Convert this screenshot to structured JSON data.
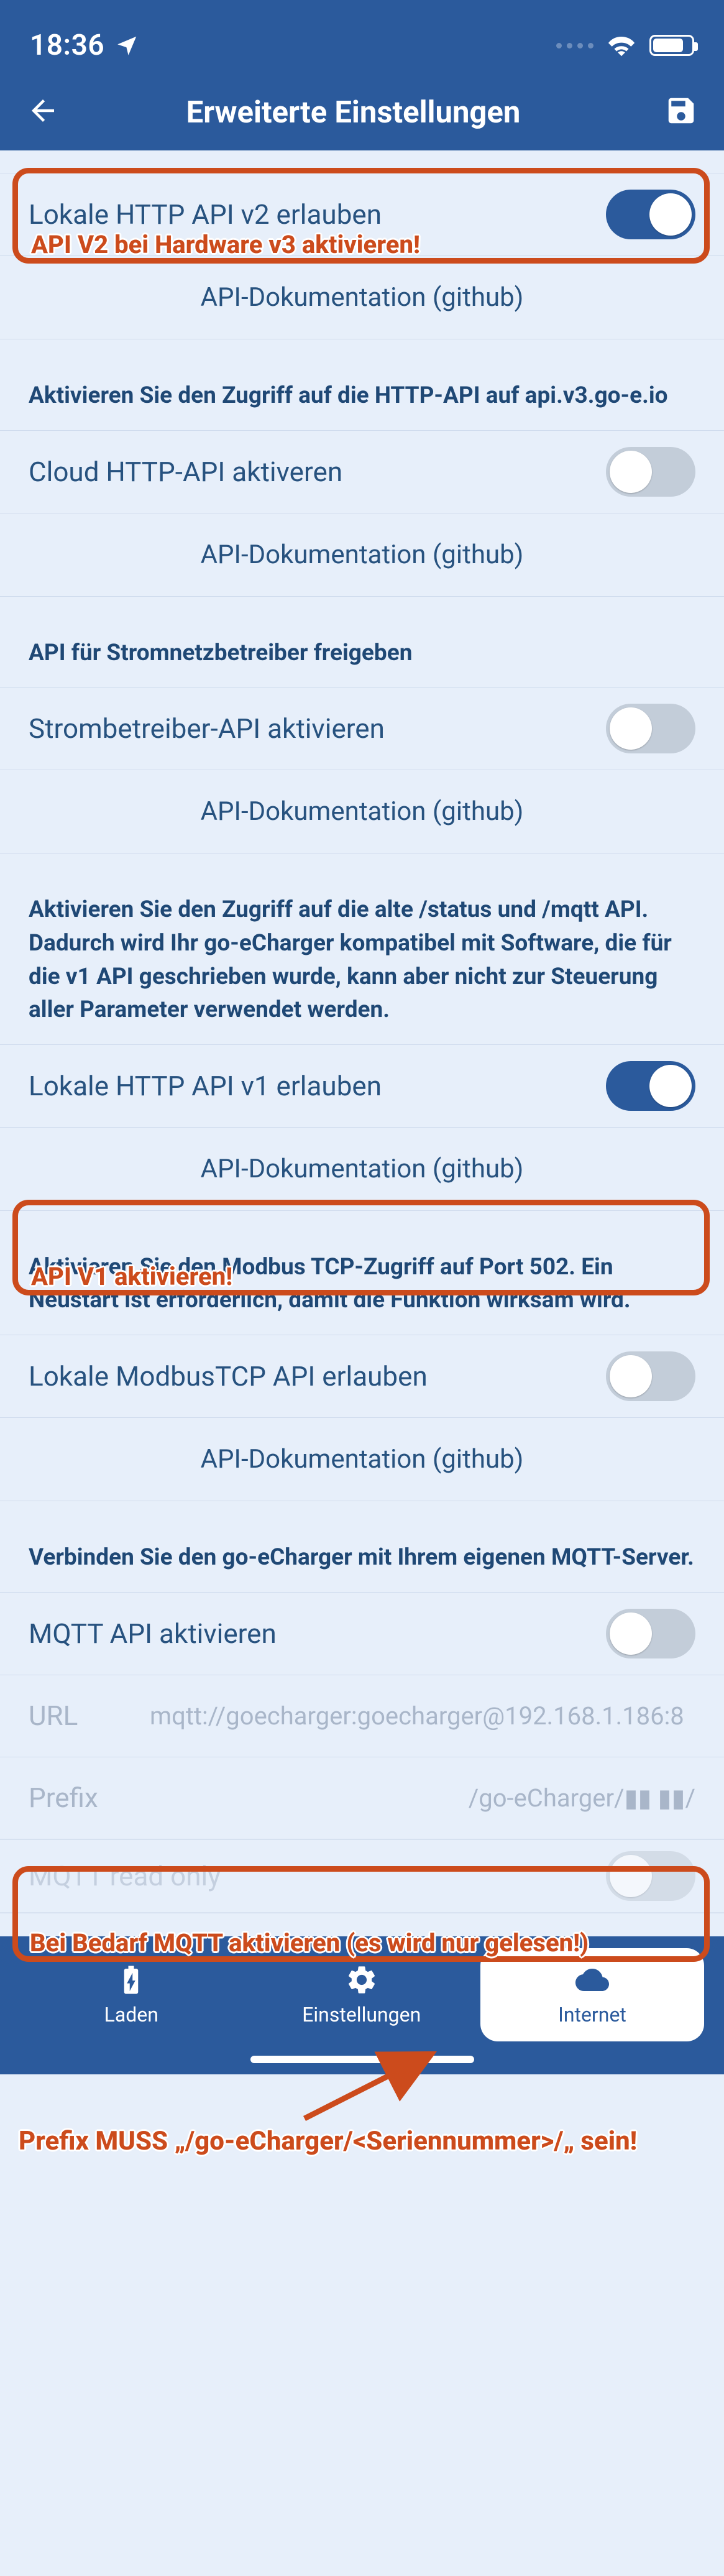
{
  "statusbar": {
    "time": "18:36"
  },
  "header": {
    "title": "Erweiterte Einstellungen"
  },
  "sections": {
    "apiv2": {
      "row_label": "Lokale HTTP API v2 erlauben",
      "doc": "API-Dokumentation (github)"
    },
    "cloud": {
      "note": "Aktivieren Sie den Zugriff auf die HTTP-API auf api.v3.go-e.io",
      "row_label": "Cloud HTTP-API aktiveren",
      "doc": "API-Dokumentation (github)"
    },
    "gridop": {
      "note": "API für Stromnetzbetreiber freigeben",
      "row_label": "Strombetreiber-API aktivieren",
      "doc": "API-Dokumentation (github)"
    },
    "apiv1": {
      "note": "Aktivieren Sie den Zugriff auf die alte /status und /mqtt API. Dadurch wird Ihr go-eCharger kompatibel mit Software, die für die v1 API geschrieben wurde, kann aber nicht zur Steuerung aller Parameter verwendet werden.",
      "row_label": "Lokale HTTP API v1 erlauben",
      "doc": "API-Dokumentation (github)"
    },
    "modbus": {
      "note": "Aktivieren Sie den Modbus TCP-Zugriff auf Port 502. Ein Neustart ist erforderlich, damit die Funktion wirksam wird.",
      "row_label": "Lokale ModbusTCP API erlauben",
      "doc": "API-Dokumentation (github)"
    },
    "mqtt": {
      "note": "Verbinden Sie den go-eCharger mit Ihrem eigenen MQTT-Server.",
      "row_label": "MQTT API aktivieren",
      "url_key": "URL",
      "url_val": "mqtt://goecharger:goecharger@192.168.1.186:8",
      "prefix_key": "Prefix",
      "prefix_val": "/go-eCharger/▮▮ ▮▮/",
      "readonly_label": "MQTT read only"
    }
  },
  "annotations": {
    "apiv2": "API V2 bei Hardware v3 aktivieren!",
    "apiv1": "API V1 aktivieren!",
    "mqtt": "Bei Bedarf MQTT aktivieren (es wird nur gelesen!)",
    "prefix": "Prefix MUSS „/go-eCharger/<Seriennummer>/„ sein!"
  },
  "tabs": {
    "laden": "Laden",
    "einstellungen": "Einstellungen",
    "internet": "Internet"
  }
}
